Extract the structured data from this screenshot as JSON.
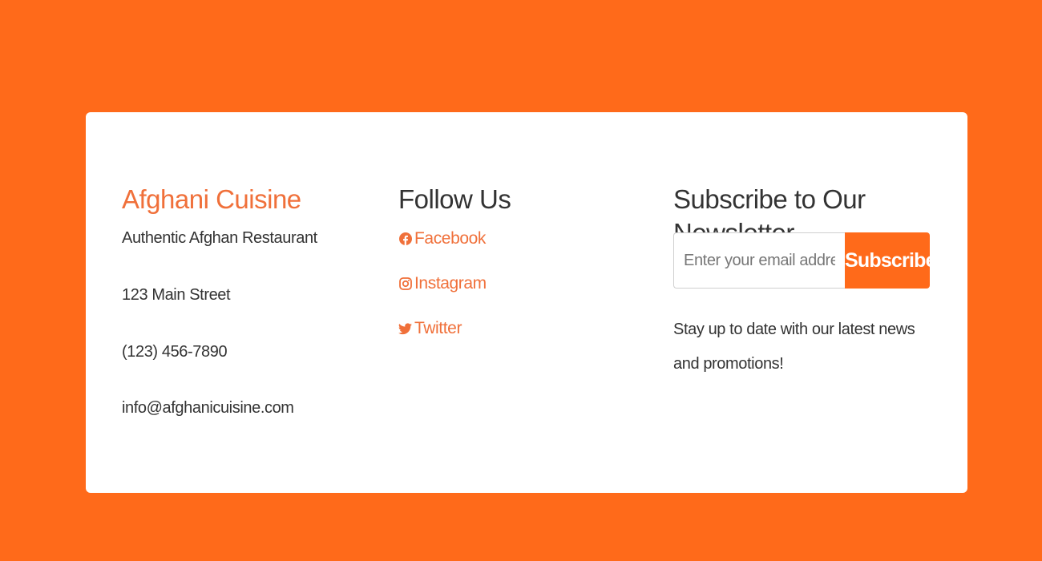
{
  "brand": {
    "name": "Afghani Cuisine",
    "tagline": "Authentic Afghan Restaurant",
    "address": "123 Main Street",
    "phone": "(123) 456-7890",
    "email": "info@afghanicuisine.com"
  },
  "follow": {
    "title": "Follow Us",
    "links": [
      {
        "label": "Facebook",
        "icon": "facebook-icon"
      },
      {
        "label": "Instagram",
        "icon": "instagram-icon"
      },
      {
        "label": "Twitter",
        "icon": "twitter-icon"
      }
    ]
  },
  "newsletter": {
    "title": "Subscribe to Our Newsletter",
    "placeholder": "Enter your email address",
    "button_label": "Subscribe",
    "description": "Stay up to date with our latest news and promotions!"
  },
  "colors": {
    "background": "#ff6a1a",
    "accent": "#f0703a",
    "text": "#333333",
    "card": "#ffffff"
  }
}
